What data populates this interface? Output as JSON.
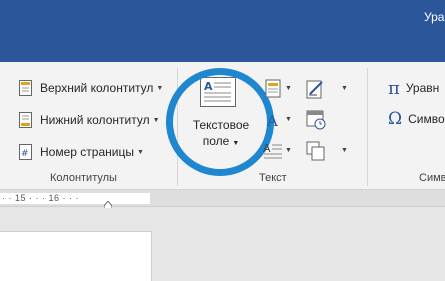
{
  "titlebar": {
    "partial_text": "Уравн"
  },
  "header_footer_group": {
    "header_label": "Верхний колонтитул",
    "footer_label": "Нижний колонтитул",
    "page_number_label": "Номер страницы",
    "group_label": "Колонтитулы"
  },
  "text_group": {
    "text_box_line1": "Текстовое",
    "text_box_line2": "поле",
    "group_label": "Текст"
  },
  "symbols_group": {
    "equation_label": "Уравн",
    "symbol_label": "Симво",
    "group_label": "Симв"
  },
  "ruler": {
    "marks": "· · 15 · · · 16 · · ·"
  },
  "colors": {
    "title_bar": "#2b579a",
    "ribbon": "#f3f3f3",
    "highlight_circle": "#1f86d0",
    "symbol_icon": "#2b579a"
  }
}
